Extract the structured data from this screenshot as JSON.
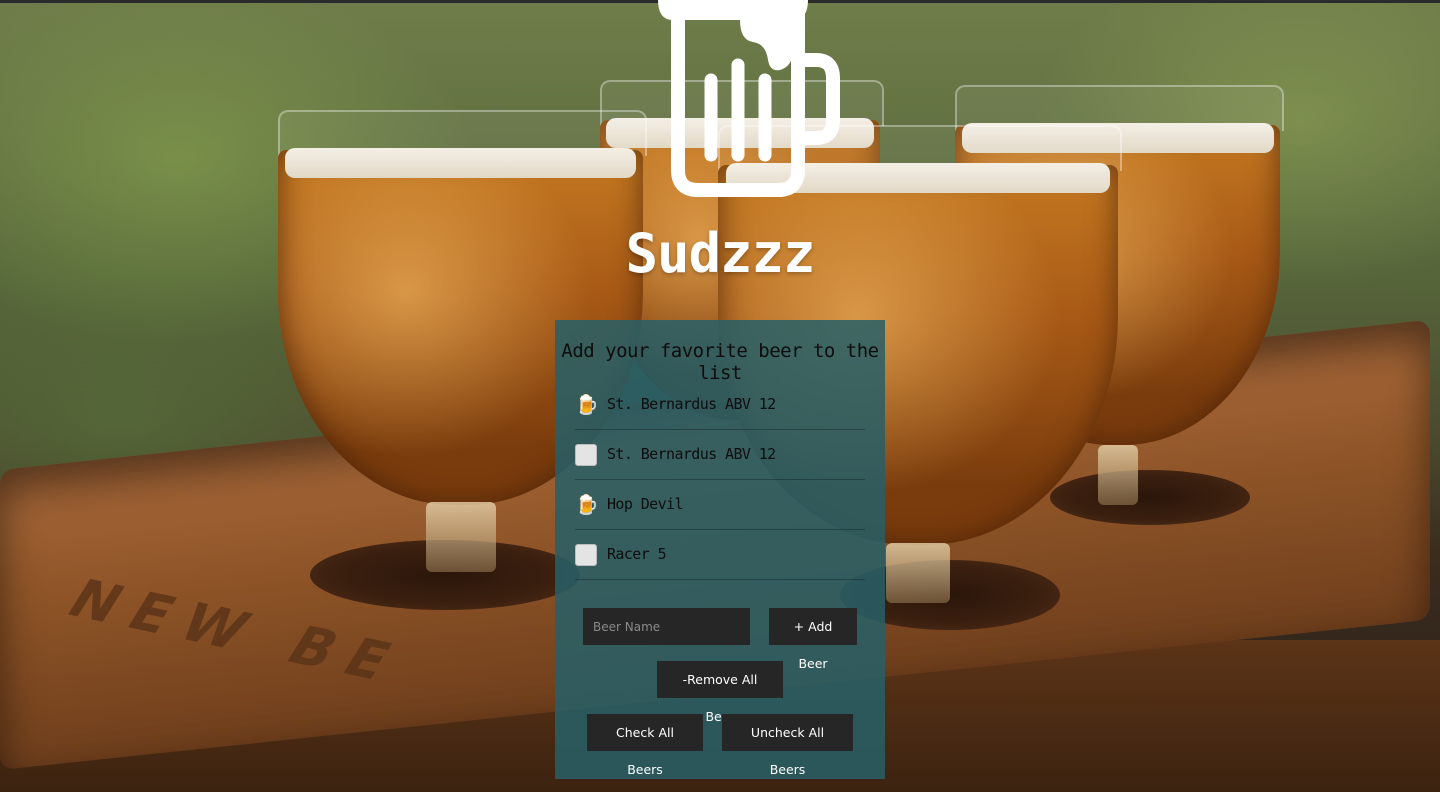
{
  "app": {
    "title": "Sudzzz",
    "logo_icon": "beer-mug-icon"
  },
  "background": {
    "board_text": "NEW BE"
  },
  "card": {
    "heading": "Add your favorite beer to the list",
    "items": [
      {
        "name": "St. Bernardus ABV 12",
        "checked": true,
        "icon": "beer-emoji-icon"
      },
      {
        "name": "St. Bernardus ABV 12",
        "checked": false,
        "icon": "checkbox-icon"
      },
      {
        "name": "Hop Devil",
        "checked": true,
        "icon": "beer-emoji-icon"
      },
      {
        "name": "Racer 5",
        "checked": false,
        "icon": "checkbox-icon"
      }
    ],
    "input": {
      "placeholder": "Beer Name",
      "value": ""
    },
    "buttons": {
      "add": "+ Add Beer",
      "remove_all": "-Remove All Beer",
      "check_all": "Check All Beers",
      "uncheck_all": "Uncheck All Beers"
    }
  },
  "colors": {
    "card_bg": "#286068",
    "button_bg": "#262626",
    "text_dark": "#0d0d0d",
    "title_white": "#ffffff"
  }
}
